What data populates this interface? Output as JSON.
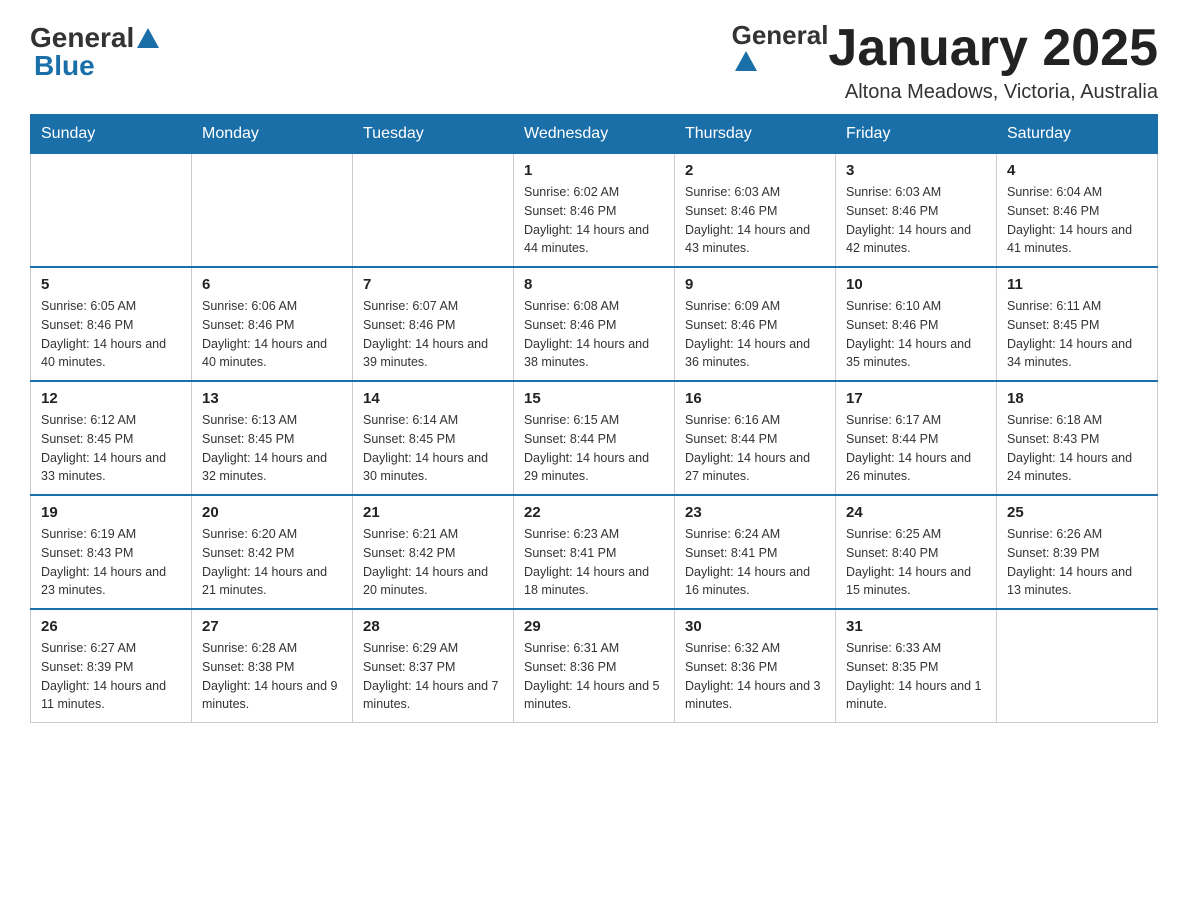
{
  "logo": {
    "text_general": "General",
    "text_blue": "Blue"
  },
  "title": "January 2025",
  "subtitle": "Altona Meadows, Victoria, Australia",
  "days_of_week": [
    "Sunday",
    "Monday",
    "Tuesday",
    "Wednesday",
    "Thursday",
    "Friday",
    "Saturday"
  ],
  "weeks": [
    [
      {
        "day": "",
        "info": ""
      },
      {
        "day": "",
        "info": ""
      },
      {
        "day": "",
        "info": ""
      },
      {
        "day": "1",
        "info": "Sunrise: 6:02 AM\nSunset: 8:46 PM\nDaylight: 14 hours and 44 minutes."
      },
      {
        "day": "2",
        "info": "Sunrise: 6:03 AM\nSunset: 8:46 PM\nDaylight: 14 hours and 43 minutes."
      },
      {
        "day": "3",
        "info": "Sunrise: 6:03 AM\nSunset: 8:46 PM\nDaylight: 14 hours and 42 minutes."
      },
      {
        "day": "4",
        "info": "Sunrise: 6:04 AM\nSunset: 8:46 PM\nDaylight: 14 hours and 41 minutes."
      }
    ],
    [
      {
        "day": "5",
        "info": "Sunrise: 6:05 AM\nSunset: 8:46 PM\nDaylight: 14 hours and 40 minutes."
      },
      {
        "day": "6",
        "info": "Sunrise: 6:06 AM\nSunset: 8:46 PM\nDaylight: 14 hours and 40 minutes."
      },
      {
        "day": "7",
        "info": "Sunrise: 6:07 AM\nSunset: 8:46 PM\nDaylight: 14 hours and 39 minutes."
      },
      {
        "day": "8",
        "info": "Sunrise: 6:08 AM\nSunset: 8:46 PM\nDaylight: 14 hours and 38 minutes."
      },
      {
        "day": "9",
        "info": "Sunrise: 6:09 AM\nSunset: 8:46 PM\nDaylight: 14 hours and 36 minutes."
      },
      {
        "day": "10",
        "info": "Sunrise: 6:10 AM\nSunset: 8:46 PM\nDaylight: 14 hours and 35 minutes."
      },
      {
        "day": "11",
        "info": "Sunrise: 6:11 AM\nSunset: 8:45 PM\nDaylight: 14 hours and 34 minutes."
      }
    ],
    [
      {
        "day": "12",
        "info": "Sunrise: 6:12 AM\nSunset: 8:45 PM\nDaylight: 14 hours and 33 minutes."
      },
      {
        "day": "13",
        "info": "Sunrise: 6:13 AM\nSunset: 8:45 PM\nDaylight: 14 hours and 32 minutes."
      },
      {
        "day": "14",
        "info": "Sunrise: 6:14 AM\nSunset: 8:45 PM\nDaylight: 14 hours and 30 minutes."
      },
      {
        "day": "15",
        "info": "Sunrise: 6:15 AM\nSunset: 8:44 PM\nDaylight: 14 hours and 29 minutes."
      },
      {
        "day": "16",
        "info": "Sunrise: 6:16 AM\nSunset: 8:44 PM\nDaylight: 14 hours and 27 minutes."
      },
      {
        "day": "17",
        "info": "Sunrise: 6:17 AM\nSunset: 8:44 PM\nDaylight: 14 hours and 26 minutes."
      },
      {
        "day": "18",
        "info": "Sunrise: 6:18 AM\nSunset: 8:43 PM\nDaylight: 14 hours and 24 minutes."
      }
    ],
    [
      {
        "day": "19",
        "info": "Sunrise: 6:19 AM\nSunset: 8:43 PM\nDaylight: 14 hours and 23 minutes."
      },
      {
        "day": "20",
        "info": "Sunrise: 6:20 AM\nSunset: 8:42 PM\nDaylight: 14 hours and 21 minutes."
      },
      {
        "day": "21",
        "info": "Sunrise: 6:21 AM\nSunset: 8:42 PM\nDaylight: 14 hours and 20 minutes."
      },
      {
        "day": "22",
        "info": "Sunrise: 6:23 AM\nSunset: 8:41 PM\nDaylight: 14 hours and 18 minutes."
      },
      {
        "day": "23",
        "info": "Sunrise: 6:24 AM\nSunset: 8:41 PM\nDaylight: 14 hours and 16 minutes."
      },
      {
        "day": "24",
        "info": "Sunrise: 6:25 AM\nSunset: 8:40 PM\nDaylight: 14 hours and 15 minutes."
      },
      {
        "day": "25",
        "info": "Sunrise: 6:26 AM\nSunset: 8:39 PM\nDaylight: 14 hours and 13 minutes."
      }
    ],
    [
      {
        "day": "26",
        "info": "Sunrise: 6:27 AM\nSunset: 8:39 PM\nDaylight: 14 hours and 11 minutes."
      },
      {
        "day": "27",
        "info": "Sunrise: 6:28 AM\nSunset: 8:38 PM\nDaylight: 14 hours and 9 minutes."
      },
      {
        "day": "28",
        "info": "Sunrise: 6:29 AM\nSunset: 8:37 PM\nDaylight: 14 hours and 7 minutes."
      },
      {
        "day": "29",
        "info": "Sunrise: 6:31 AM\nSunset: 8:36 PM\nDaylight: 14 hours and 5 minutes."
      },
      {
        "day": "30",
        "info": "Sunrise: 6:32 AM\nSunset: 8:36 PM\nDaylight: 14 hours and 3 minutes."
      },
      {
        "day": "31",
        "info": "Sunrise: 6:33 AM\nSunset: 8:35 PM\nDaylight: 14 hours and 1 minute."
      },
      {
        "day": "",
        "info": ""
      }
    ]
  ]
}
